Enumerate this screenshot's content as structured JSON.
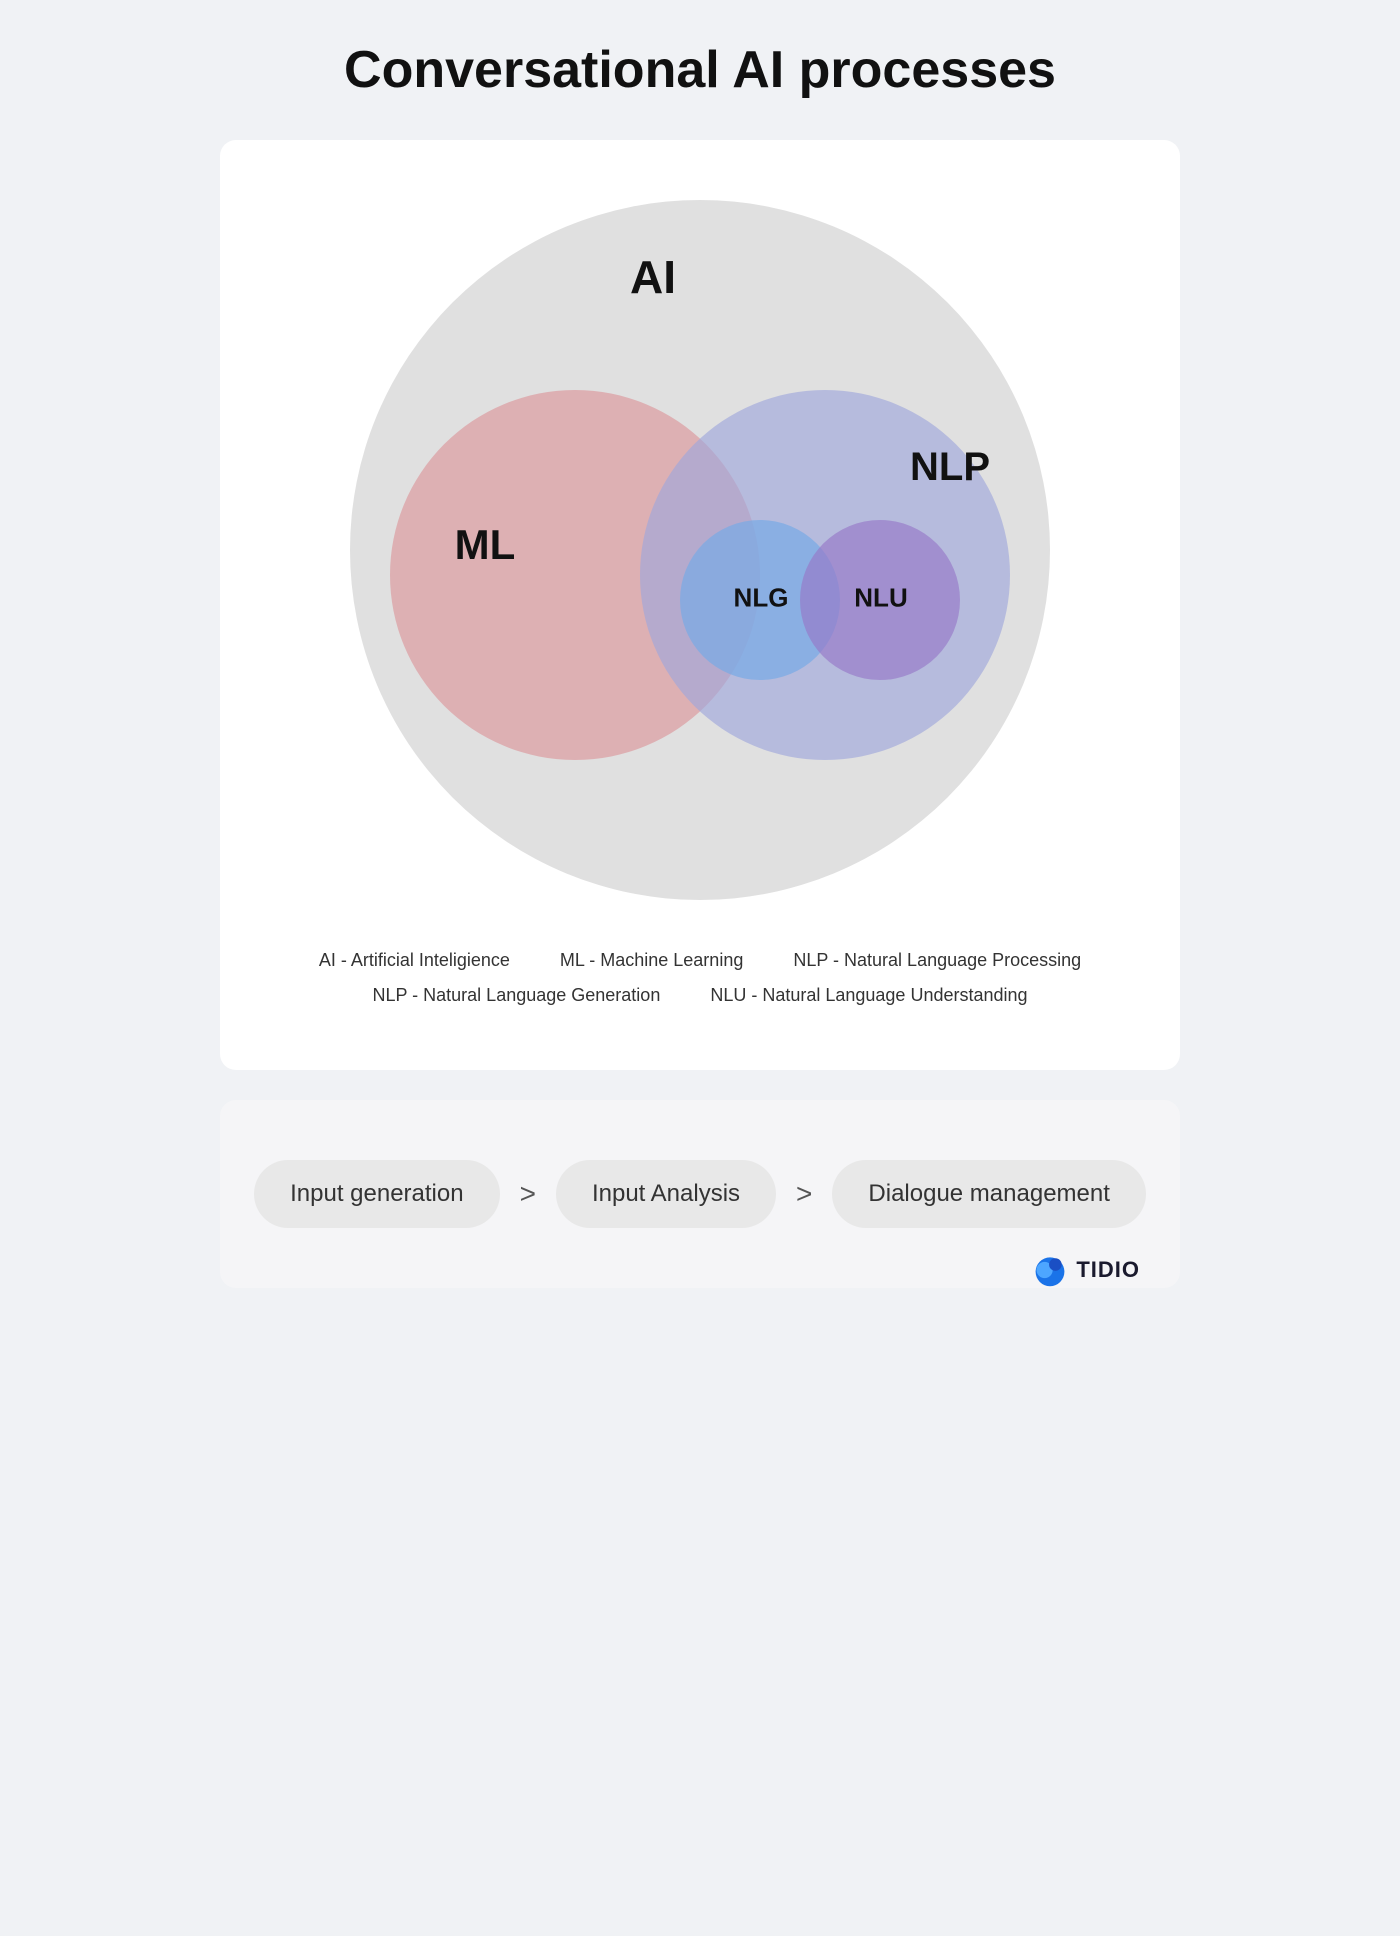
{
  "page": {
    "title": "Conversational AI processes",
    "background_color": "#f0f2f5"
  },
  "venn": {
    "circles": {
      "ai": {
        "label": "AI"
      },
      "ml": {
        "label": "ML"
      },
      "nlp": {
        "label": "NLP"
      },
      "nlg": {
        "label": "NLG"
      },
      "nlu": {
        "label": "NLU"
      }
    }
  },
  "legend": {
    "row1": [
      {
        "text": "AI - Artificial Inteligience"
      },
      {
        "text": "ML - Machine Learning"
      },
      {
        "text": "NLP - Natural Language Processing"
      }
    ],
    "row2": [
      {
        "text": "NLP - Natural Language Generation"
      },
      {
        "text": "NLU - Natural Language Understanding"
      }
    ]
  },
  "flow": {
    "steps": [
      {
        "label": "Input generation"
      },
      {
        "label": "Input Analysis"
      },
      {
        "label": "Dialogue management"
      }
    ],
    "arrow": ">"
  },
  "tidio": {
    "name": "TIDIO"
  }
}
